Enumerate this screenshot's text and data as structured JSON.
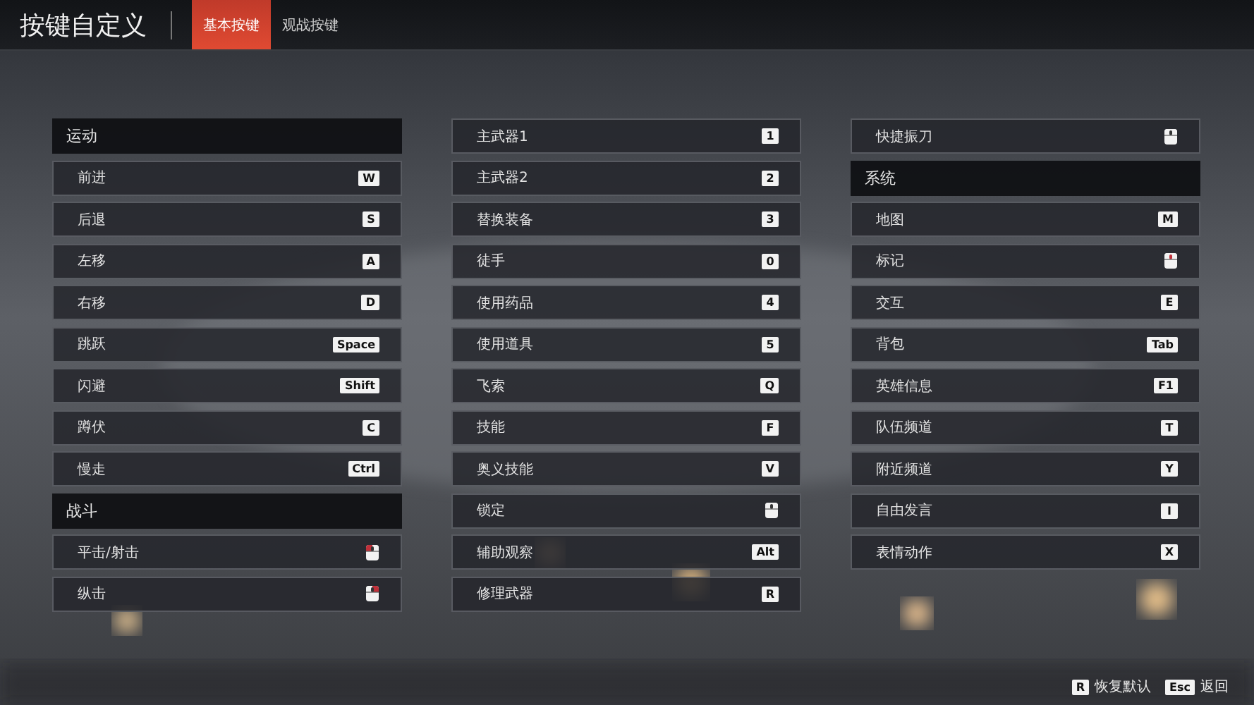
{
  "title": "按键自定义",
  "tabs": [
    {
      "label": "基本按键",
      "selected": true
    },
    {
      "label": "观战按键",
      "selected": false
    }
  ],
  "columns": [
    [
      {
        "kind": "header",
        "label": "运动"
      },
      {
        "kind": "binding",
        "label": "前进",
        "key": {
          "kind": "text",
          "text": "W"
        }
      },
      {
        "kind": "binding",
        "label": "后退",
        "key": {
          "kind": "text",
          "text": "S"
        }
      },
      {
        "kind": "binding",
        "label": "左移",
        "key": {
          "kind": "text",
          "text": "A"
        }
      },
      {
        "kind": "binding",
        "label": "右移",
        "key": {
          "kind": "text",
          "text": "D"
        }
      },
      {
        "kind": "binding",
        "label": "跳跃",
        "key": {
          "kind": "text",
          "text": "Space"
        }
      },
      {
        "kind": "binding",
        "label": "闪避",
        "key": {
          "kind": "text",
          "text": "Shift"
        }
      },
      {
        "kind": "binding",
        "label": "蹲伏",
        "key": {
          "kind": "text",
          "text": "C"
        }
      },
      {
        "kind": "binding",
        "label": "慢走",
        "key": {
          "kind": "text",
          "text": "Ctrl"
        }
      },
      {
        "kind": "header",
        "label": "战斗"
      },
      {
        "kind": "binding",
        "label": "平击/射击",
        "key": {
          "kind": "mouse",
          "left": true,
          "right": false,
          "wheel": false
        }
      },
      {
        "kind": "binding",
        "label": "纵击",
        "key": {
          "kind": "mouse",
          "left": false,
          "right": true,
          "wheel": false
        }
      }
    ],
    [
      {
        "kind": "binding",
        "label": "主武器1",
        "key": {
          "kind": "text",
          "text": "1"
        }
      },
      {
        "kind": "binding",
        "label": "主武器2",
        "key": {
          "kind": "text",
          "text": "2"
        }
      },
      {
        "kind": "binding",
        "label": "替换装备",
        "key": {
          "kind": "text",
          "text": "3"
        }
      },
      {
        "kind": "binding",
        "label": "徒手",
        "key": {
          "kind": "text",
          "text": "0"
        }
      },
      {
        "kind": "binding",
        "label": "使用药品",
        "key": {
          "kind": "text",
          "text": "4"
        }
      },
      {
        "kind": "binding",
        "label": "使用道具",
        "key": {
          "kind": "text",
          "text": "5"
        }
      },
      {
        "kind": "binding",
        "label": "飞索",
        "key": {
          "kind": "text",
          "text": "Q"
        }
      },
      {
        "kind": "binding",
        "label": "技能",
        "key": {
          "kind": "text",
          "text": "F"
        }
      },
      {
        "kind": "binding",
        "label": "奥义技能",
        "key": {
          "kind": "text",
          "text": "V"
        }
      },
      {
        "kind": "binding",
        "label": "锁定",
        "key": {
          "kind": "mouse",
          "left": false,
          "right": false,
          "wheel": false
        }
      },
      {
        "kind": "binding",
        "label": "辅助观察",
        "key": {
          "kind": "text",
          "text": "Alt"
        }
      },
      {
        "kind": "binding",
        "label": "修理武器",
        "key": {
          "kind": "text",
          "text": "R"
        }
      }
    ],
    [
      {
        "kind": "binding",
        "label": "快捷振刀",
        "key": {
          "kind": "mouse",
          "left": false,
          "right": false,
          "wheel": false
        }
      },
      {
        "kind": "header",
        "label": "系统"
      },
      {
        "kind": "binding",
        "label": "地图",
        "key": {
          "kind": "text",
          "text": "M"
        }
      },
      {
        "kind": "binding",
        "label": "标记",
        "key": {
          "kind": "mouse",
          "left": false,
          "right": false,
          "wheel": true
        }
      },
      {
        "kind": "binding",
        "label": "交互",
        "key": {
          "kind": "text",
          "text": "E"
        }
      },
      {
        "kind": "binding",
        "label": "背包",
        "key": {
          "kind": "text",
          "text": "Tab"
        }
      },
      {
        "kind": "binding",
        "label": "英雄信息",
        "key": {
          "kind": "text",
          "text": "F1"
        }
      },
      {
        "kind": "binding",
        "label": "队伍频道",
        "key": {
          "kind": "text",
          "text": "T"
        }
      },
      {
        "kind": "binding",
        "label": "附近频道",
        "key": {
          "kind": "text",
          "text": "Y"
        }
      },
      {
        "kind": "binding",
        "label": "自由发言",
        "key": {
          "kind": "text",
          "text": "I"
        }
      },
      {
        "kind": "binding",
        "label": "表情动作",
        "key": {
          "kind": "text",
          "text": "X"
        }
      }
    ]
  ],
  "footer": [
    {
      "key": "R",
      "label": "恢复默认"
    },
    {
      "key": "Esc",
      "label": "返回"
    }
  ]
}
